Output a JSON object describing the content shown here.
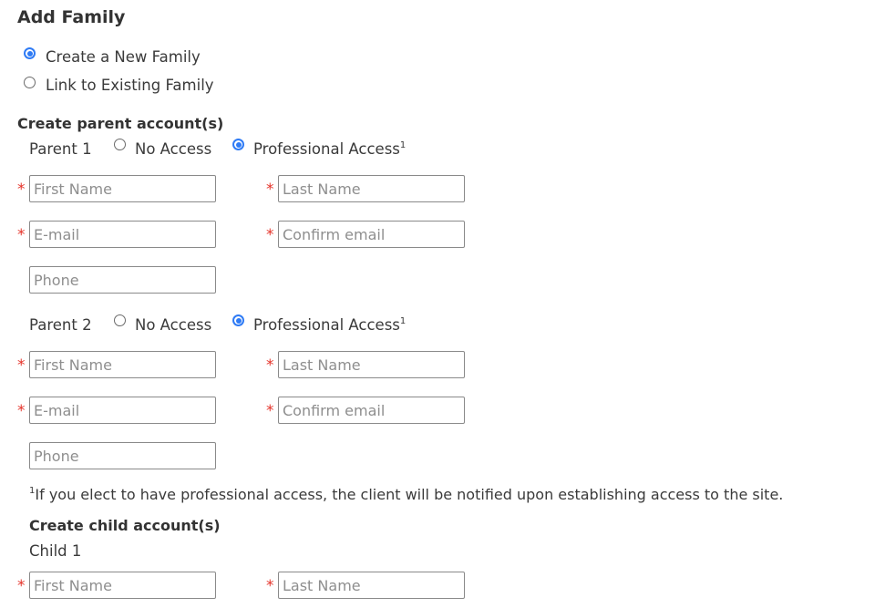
{
  "page": {
    "title": "Add Family",
    "family_options": [
      {
        "label": "Create a New Family",
        "checked": true
      },
      {
        "label": "Link to Existing Family",
        "checked": false
      }
    ]
  },
  "parents": {
    "heading": "Create parent account(s)",
    "list": [
      {
        "label": "Parent 1",
        "access_options": [
          {
            "label": "No Access",
            "checked": false
          },
          {
            "label": "Professional Access",
            "sup": "1",
            "checked": true
          }
        ],
        "fields": {
          "first_name": {
            "placeholder": "First Name",
            "value": "",
            "required": true
          },
          "last_name": {
            "placeholder": "Last Name",
            "value": "",
            "required": true
          },
          "email": {
            "placeholder": "E-mail",
            "value": "",
            "required": true
          },
          "confirm_email": {
            "placeholder": "Confirm email",
            "value": "",
            "required": true
          },
          "phone": {
            "placeholder": "Phone",
            "value": "",
            "required": false
          }
        }
      },
      {
        "label": "Parent 2",
        "access_options": [
          {
            "label": "No Access",
            "checked": false
          },
          {
            "label": "Professional Access",
            "sup": "1",
            "checked": true
          }
        ],
        "fields": {
          "first_name": {
            "placeholder": "First Name",
            "value": "",
            "required": true
          },
          "last_name": {
            "placeholder": "Last Name",
            "value": "",
            "required": true
          },
          "email": {
            "placeholder": "E-mail",
            "value": "",
            "required": true
          },
          "confirm_email": {
            "placeholder": "Confirm email",
            "value": "",
            "required": true
          },
          "phone": {
            "placeholder": "Phone",
            "value": "",
            "required": false
          }
        }
      }
    ],
    "footnote": {
      "marker": "1",
      "text": "If you elect to have professional access, the client will be notified upon establishing access to the site."
    }
  },
  "children": {
    "heading": "Create child account(s)",
    "list": [
      {
        "label": "Child 1",
        "fields": {
          "first_name": {
            "placeholder": "First Name",
            "value": "",
            "required": true
          },
          "last_name": {
            "placeholder": "Last Name",
            "value": "",
            "required": true
          }
        }
      }
    ]
  },
  "symbols": {
    "required": "*"
  },
  "colors": {
    "accent": "#2f7bf5",
    "required": "#e5332a",
    "text": "#333333",
    "placeholder": "#8e8e8e"
  }
}
